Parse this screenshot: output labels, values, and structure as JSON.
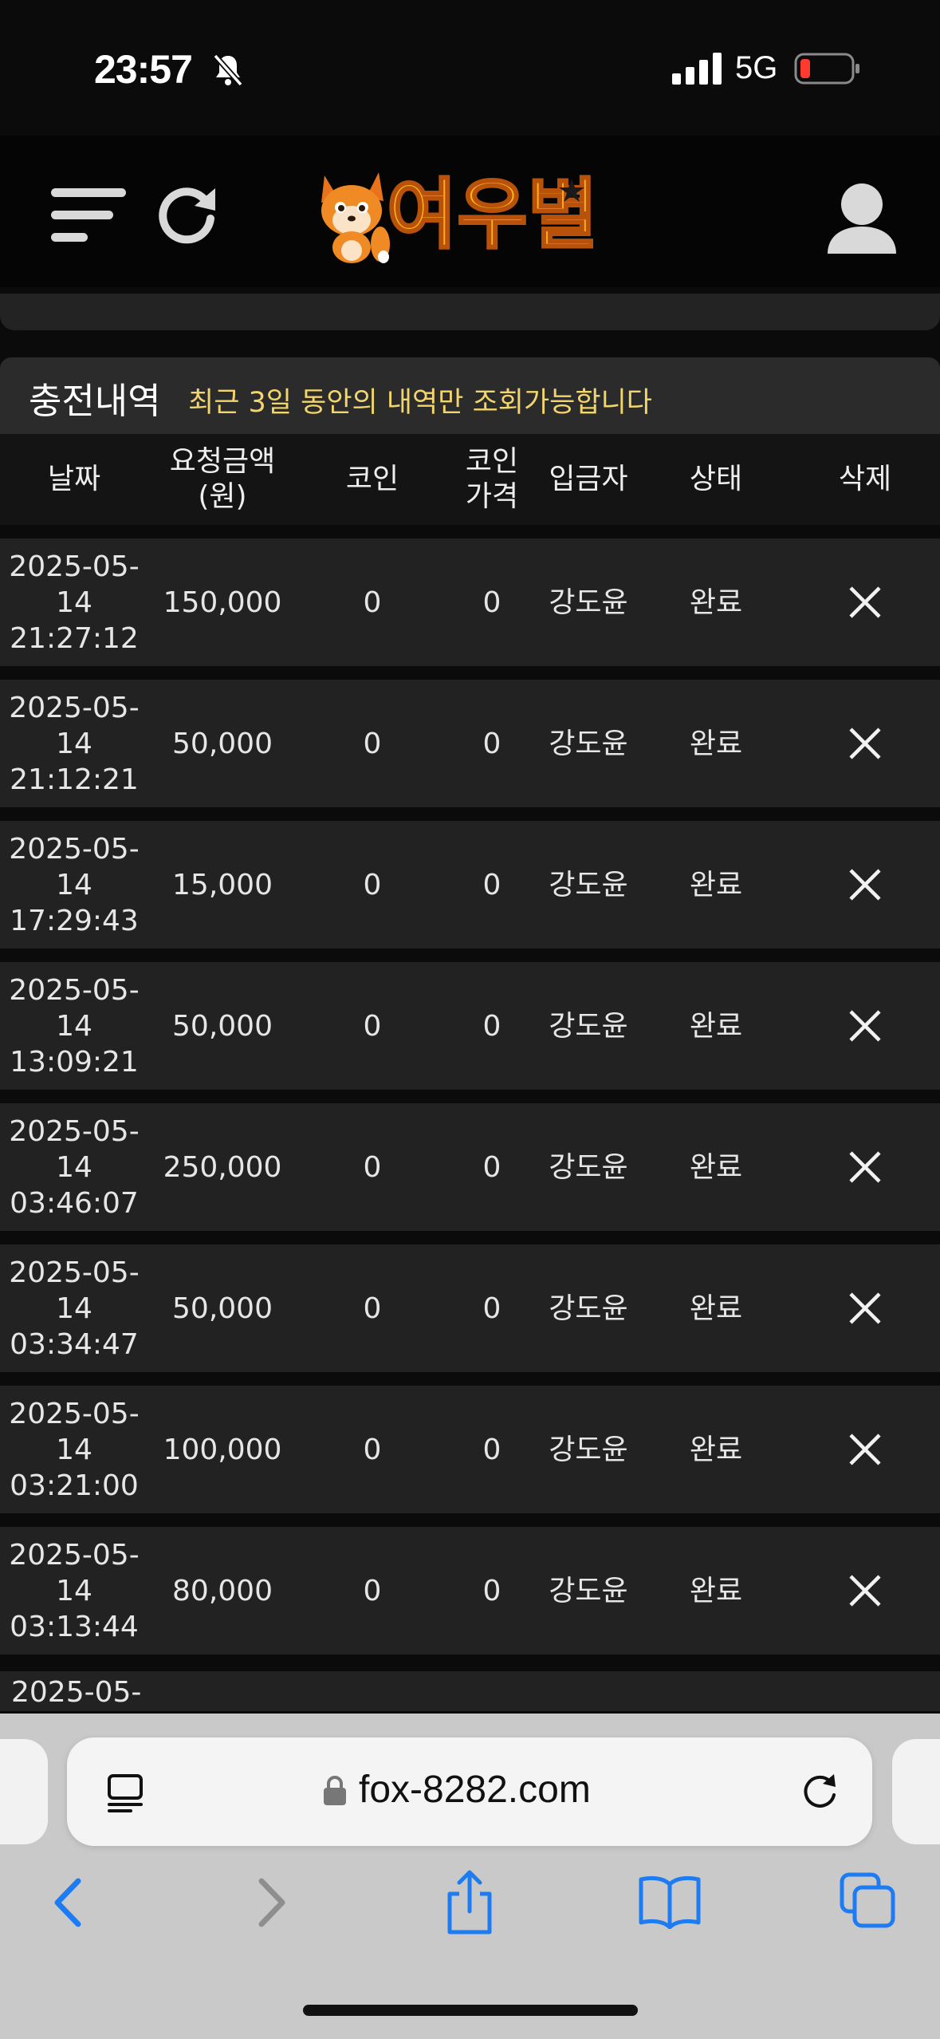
{
  "status_bar": {
    "time": "23:57",
    "network": "5G",
    "icons": [
      "bell-muted-icon",
      "signal-icon",
      "battery-low-icon"
    ]
  },
  "header": {
    "logo_text": "여우별",
    "icons": [
      "menu-icon",
      "refresh-icon",
      "fox-mascot-icon",
      "user-icon"
    ]
  },
  "section": {
    "title": "충전내역",
    "note": "최근 3일 동안의 내역만 조회가능합니다"
  },
  "table": {
    "columns": [
      {
        "key": "date",
        "label": "날짜"
      },
      {
        "key": "amount",
        "label": "요청금액\n(원)"
      },
      {
        "key": "coin",
        "label": "코인"
      },
      {
        "key": "price",
        "label": "코인\n가격"
      },
      {
        "key": "depositor",
        "label": "입금자"
      },
      {
        "key": "status",
        "label": "상태"
      },
      {
        "key": "delete",
        "label": "삭제"
      }
    ],
    "rows": [
      {
        "date": "2025-05-\n14\n21:27:12",
        "amount": "150,000",
        "coin": "0",
        "price": "0",
        "depositor": "강도윤",
        "status": "완료"
      },
      {
        "date": "2025-05-\n14\n21:12:21",
        "amount": "50,000",
        "coin": "0",
        "price": "0",
        "depositor": "강도윤",
        "status": "완료"
      },
      {
        "date": "2025-05-\n14\n17:29:43",
        "amount": "15,000",
        "coin": "0",
        "price": "0",
        "depositor": "강도윤",
        "status": "완료"
      },
      {
        "date": "2025-05-\n14\n13:09:21",
        "amount": "50,000",
        "coin": "0",
        "price": "0",
        "depositor": "강도윤",
        "status": "완료"
      },
      {
        "date": "2025-05-\n14\n03:46:07",
        "amount": "250,000",
        "coin": "0",
        "price": "0",
        "depositor": "강도윤",
        "status": "완료"
      },
      {
        "date": "2025-05-\n14\n03:34:47",
        "amount": "50,000",
        "coin": "0",
        "price": "0",
        "depositor": "강도윤",
        "status": "완료"
      },
      {
        "date": "2025-05-\n14\n03:21:00",
        "amount": "100,000",
        "coin": "0",
        "price": "0",
        "depositor": "강도윤",
        "status": "완료"
      },
      {
        "date": "2025-05-\n14\n03:13:44",
        "amount": "80,000",
        "coin": "0",
        "price": "0",
        "depositor": "강도윤",
        "status": "완료"
      }
    ],
    "partial_row_date": "2025-05-"
  },
  "browser": {
    "url": "fox-8282.com",
    "icons": [
      "reader-icon",
      "lock-icon",
      "reload-icon",
      "back-icon",
      "forward-icon",
      "share-icon",
      "bookmarks-icon",
      "tabs-icon"
    ]
  },
  "colors": {
    "note_yellow": "#f2d56b",
    "logo_orange": "#ffb21a",
    "ios_blue": "#1e7cf2",
    "battery_red": "#ff3b30"
  }
}
